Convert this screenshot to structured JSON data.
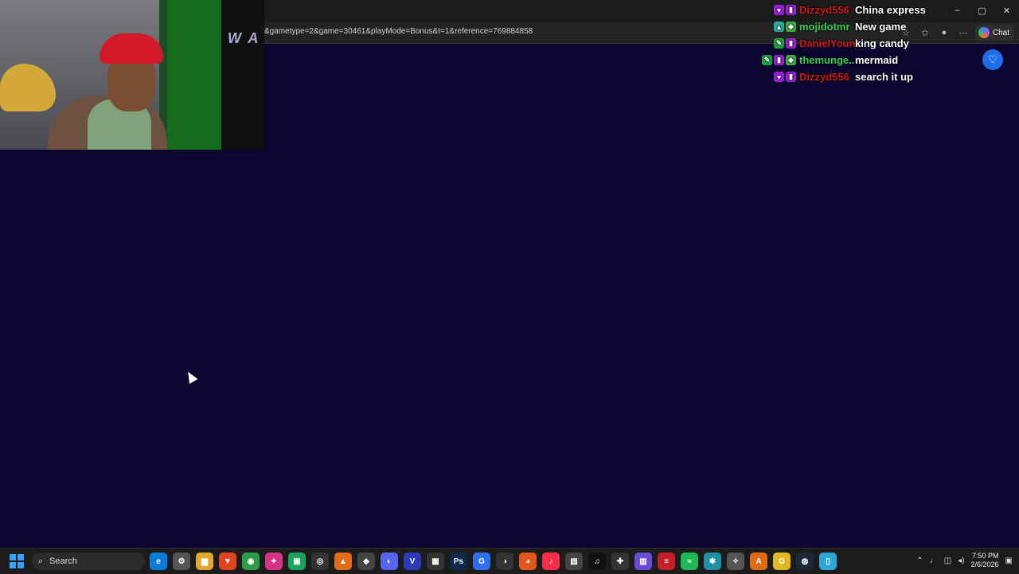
{
  "browser": {
    "url": "&gametype=2&game=30461&playMode=Bonus&t=1&reference=769884858",
    "chat_button_label": "Chat",
    "window_controls": [
      "–",
      "▢",
      "✕"
    ]
  },
  "chat_overlay": {
    "messages": [
      {
        "user": "Dizzyd556",
        "user_color": "#d21a1a",
        "badges": [
          "heart",
          "sub"
        ],
        "text": "China express"
      },
      {
        "user": "mojidotmr",
        "user_color": "#39d353",
        "badges": [
          "turbo",
          "green"
        ],
        "text": "New game"
      },
      {
        "user": "DanielYoung...",
        "user_color": "#d21a1a",
        "badges": [
          "mod",
          "sub"
        ],
        "text": "king candy"
      },
      {
        "user": "themunge...",
        "user_color": "#39d353",
        "badges": [
          "mod",
          "sub",
          "green"
        ],
        "text": "mermaid"
      },
      {
        "user": "Dizzyd556",
        "user_color": "#d21a1a",
        "badges": [
          "heart",
          "sub"
        ],
        "text": "search it up"
      }
    ]
  },
  "webcam": {
    "logo_text": "W A"
  },
  "taskbar": {
    "search_label": "Search",
    "apps": [
      {
        "name": "edge-icon",
        "color": "#0a7cd8",
        "glyph": "e"
      },
      {
        "name": "settings-icon",
        "color": "#555",
        "glyph": "⚙"
      },
      {
        "name": "file-explorer-icon",
        "color": "#e0a82e",
        "glyph": "▆"
      },
      {
        "name": "brave-icon",
        "color": "#e0431f",
        "glyph": "▼"
      },
      {
        "name": "chrome-icon",
        "color": "#2e9b49",
        "glyph": "◉"
      },
      {
        "name": "app-pink-icon",
        "color": "#d63384",
        "glyph": "✦"
      },
      {
        "name": "app-green-icon",
        "color": "#19a35b",
        "glyph": "▣"
      },
      {
        "name": "obs-icon",
        "color": "#333",
        "glyph": "◎"
      },
      {
        "name": "app-orange-icon",
        "color": "#e26b1c",
        "glyph": "▲"
      },
      {
        "name": "gamepad-icon",
        "color": "#444",
        "glyph": "◆"
      },
      {
        "name": "discord-icon",
        "color": "#5865f2",
        "glyph": "◐"
      },
      {
        "name": "vegas-icon",
        "color": "#2b3ab8",
        "glyph": "V"
      },
      {
        "name": "capture-icon",
        "color": "#333",
        "glyph": "▦"
      },
      {
        "name": "photoshop-icon",
        "color": "#0b2a4a",
        "glyph": "Ps"
      },
      {
        "name": "app-blue-icon",
        "color": "#2f6fed",
        "glyph": "G"
      },
      {
        "name": "app-dark-icon",
        "color": "#333",
        "glyph": "◑"
      },
      {
        "name": "firefox-icon",
        "color": "#e2581c",
        "glyph": "◕"
      },
      {
        "name": "music-icon",
        "color": "#fa2d48",
        "glyph": "♪"
      },
      {
        "name": "app-gray-icon",
        "color": "#444",
        "glyph": "▤"
      },
      {
        "name": "tiktok-icon",
        "color": "#111",
        "glyph": "♫"
      },
      {
        "name": "app-network-icon",
        "color": "#333",
        "glyph": "✚"
      },
      {
        "name": "app-purple-icon",
        "color": "#6a4bd8",
        "glyph": "▥"
      },
      {
        "name": "app-red-icon",
        "color": "#c21f2a",
        "glyph": "≡"
      },
      {
        "name": "spotify-icon",
        "color": "#1db954",
        "glyph": "≈"
      },
      {
        "name": "app-teal-icon",
        "color": "#1f8fa3",
        "glyph": "✱"
      },
      {
        "name": "app-brown-icon",
        "color": "#555",
        "glyph": "✧"
      },
      {
        "name": "app-orange2-icon",
        "color": "#e06a14",
        "glyph": "A"
      },
      {
        "name": "app-yellow-icon",
        "color": "#e3b624",
        "glyph": "G"
      },
      {
        "name": "steam-icon",
        "color": "#1b2838",
        "glyph": "◍"
      },
      {
        "name": "notepad-icon",
        "color": "#2aa7d8",
        "glyph": "▯"
      }
    ],
    "time": "7:50 PM",
    "date": "2/6/2026"
  }
}
